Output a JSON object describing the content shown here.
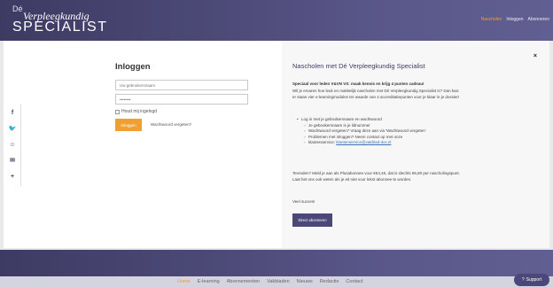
{
  "header": {
    "logo_small": "Dé",
    "logo_line1": "Verpleegkundig",
    "logo_line2": "SPECIALIST",
    "nav": [
      "Nascholen",
      "Inloggen",
      "Abonneren"
    ]
  },
  "login": {
    "title": "Inloggen",
    "username_placeholder": "Uw gebruikersnaam",
    "password_placeholder": "••••••••",
    "remember_label": "Houd mij ingelogd",
    "login_button": "Inloggen",
    "forgot_link": "Wachtwoord vergeten?"
  },
  "social": {
    "icons": [
      "facebook-icon",
      "twitter-icon",
      "reddit-icon",
      "email-icon",
      "plus-icon"
    ],
    "glyphs": [
      "f",
      "🐦",
      "☺",
      "✉",
      "+"
    ]
  },
  "info": {
    "title": "Nascholen met Dé Verpleegkundig Specialist",
    "close": "×",
    "intro_bold": "Speciaal voor leden V&VN VS: maak kennis en krijg 4 punten cadeau!",
    "intro": "Wil je ervaren hoe leuk en makkelijk nascholen met Dé Verpleegkundig Specialist is? Dan kan: er staan vier e-learningmodules ter waarde van 4 accreditatiepunten voor je klaar in je dossier!",
    "list_main": "Log in met je gebruikersnaam en wachtwoord",
    "list_sub": [
      "Je gebruikersnaam is je lidnummer",
      "Wachtwoord vergeten? Vraag deze aan via 'Wachtwoord vergeten'",
      "Problemen met inloggen? Neem contact op met onze"
    ],
    "list_service_prefix": "klantenservice: ",
    "list_service_email": "klantenservice@vakblad-dvs.nl",
    "subscription": "Tevreden? Meld je aan als Plusabonnee voor €54,45, dat is slechts €6,80 per nascholingspunt. Laat het ons ook weten als je eit niet voor lekst abonnee te worden.",
    "closing": "Veel succes!",
    "subscribe_button": "Direct abonneren"
  },
  "footer": {
    "nav": [
      "Home",
      "E-learning",
      "Abonnementen",
      "Vakbladen",
      "Nieuws",
      "Redactie",
      "Contact"
    ],
    "support_label": "Support",
    "support_icon": "?"
  },
  "colors": {
    "brand": "#4b4778",
    "accent": "#f0a030"
  }
}
